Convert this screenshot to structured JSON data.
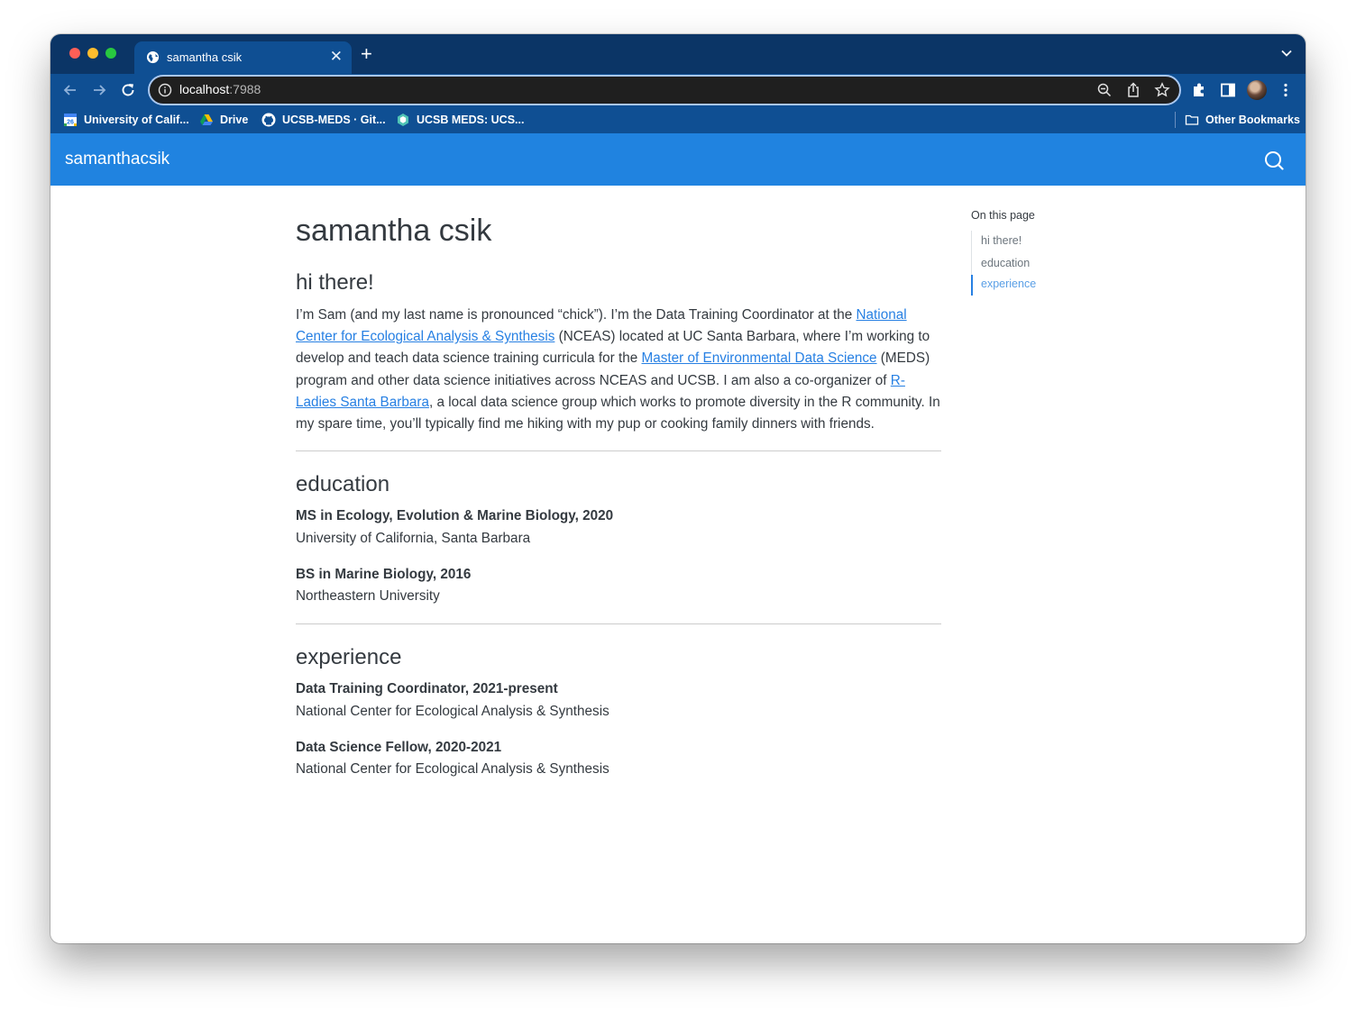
{
  "browser": {
    "tab_title": "samantha csik",
    "new_tab_symbol": "+",
    "tab_close_symbol": "✕",
    "url_host": "localhost",
    "url_port": ":7988",
    "bookmarks": [
      {
        "label": "University of Calif...",
        "icon": "calendar-icon"
      },
      {
        "label": "Drive",
        "icon": "google-drive-icon"
      },
      {
        "label": "UCSB-MEDS · Git...",
        "icon": "github-icon"
      },
      {
        "label": "UCSB MEDS: UCS...",
        "icon": "hexagon-logo-icon"
      }
    ],
    "other_bookmarks": "Other Bookmarks",
    "calendar_icon_text": "26"
  },
  "site": {
    "brand": "samanthacsik",
    "page_title": "samantha csik",
    "intro": {
      "heading": "hi there!",
      "t1": "I’m Sam (and my last name is pronounced “chick”). I’m the Data Training Coordinator at the ",
      "link1": "National Center for Ecological Analysis & Synthesis",
      "t2": " (NCEAS) located at UC Santa Barbara, where I’m working to develop and teach data science training curricula for the ",
      "link2": "Master of Environmental Data Science",
      "t3": " (MEDS) program and other data science initiatives across NCEAS and UCSB. I am also a co-organizer of ",
      "link3": "R-Ladies Santa Barbara",
      "t4": ", a local data science group which works to promote diversity in the R community. In my spare time, you’ll typically find me hiking with my pup or cooking family dinners with friends."
    },
    "education": {
      "heading": "education",
      "items": [
        {
          "title": "MS in Ecology, Evolution & Marine Biology, 2020",
          "subtitle": "University of California, Santa Barbara"
        },
        {
          "title": "BS in Marine Biology, 2016",
          "subtitle": "Northeastern University"
        }
      ]
    },
    "experience": {
      "heading": "experience",
      "items": [
        {
          "title": "Data Training Coordinator, 2021-present",
          "subtitle": "National Center for Ecological Analysis & Synthesis"
        },
        {
          "title": "Data Science Fellow, 2020-2021",
          "subtitle": "National Center for Ecological Analysis & Synthesis"
        }
      ]
    },
    "toc": {
      "title": "On this page",
      "links": [
        "hi there!",
        "education",
        "experience"
      ],
      "active_index": 2
    },
    "colors": {
      "navbar": "#2083e0",
      "link": "#2780e3",
      "text": "#343a40",
      "browser_frame": "#0b3566",
      "browser_toolbar": "#0f4f93"
    }
  }
}
